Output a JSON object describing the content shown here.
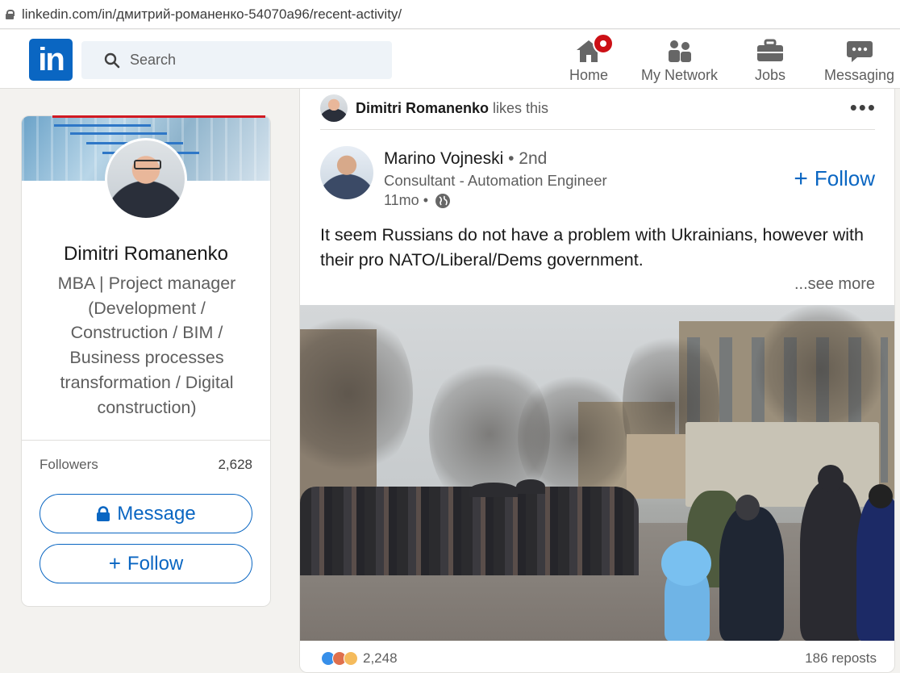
{
  "browser": {
    "url": "linkedin.com/in/дмитрий-романенко-54070a96/recent-activity/"
  },
  "nav": {
    "search_placeholder": "Search",
    "items": [
      {
        "label": "Home",
        "icon": "home-icon"
      },
      {
        "label": "My Network",
        "icon": "network-icon"
      },
      {
        "label": "Jobs",
        "icon": "briefcase-icon"
      },
      {
        "label": "Messaging",
        "icon": "messaging-icon"
      }
    ]
  },
  "profile": {
    "name": "Dimitri Romanenko",
    "headline": "MBA | Project manager (Development / Construction / BIM / Business processes transformation / Digital construction)",
    "followers_label": "Followers",
    "followers_count": "2,628",
    "message_label": "Message",
    "follow_label": "Follow"
  },
  "post": {
    "liker_name": "Dimitri Romanenko",
    "liker_action": "likes this",
    "author_name": "Marino Vojneski",
    "author_degree": "• 2nd",
    "author_title": "Consultant - Automation Engineer",
    "time": "11mo •",
    "follow_label": "Follow",
    "text": "It seem Russians do not have a problem with Ukrainians, however with their pro NATO/Liberal/Dems government.",
    "see_more": "...see more",
    "reactions_count": "2,248",
    "reposts": "186 reposts"
  },
  "colors": {
    "brand": "#0a66c2",
    "badge": "#cc1016",
    "highlight_underline": "#d11a22"
  }
}
